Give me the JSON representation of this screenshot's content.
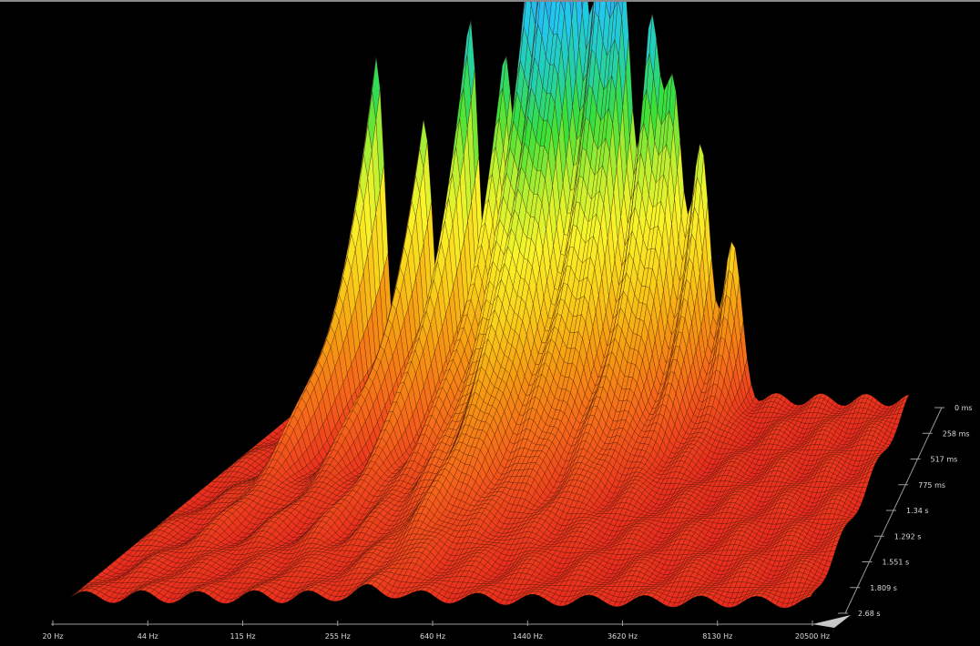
{
  "chart_data": {
    "type": "waterfall-3d",
    "x_ticks": [
      "20 Hz",
      "44 Hz",
      "115 Hz",
      "255 Hz",
      "640 Hz",
      "1440 Hz",
      "3620 Hz",
      "8130 Hz",
      "20500 Hz"
    ],
    "x_range_hz": [
      20,
      20500
    ],
    "x_scale": "log",
    "z_ticks": [
      "0 ms",
      "258 ms",
      "517 ms",
      "775 ms",
      "1.34 s",
      "1.292 s",
      "1.551 s",
      "1.809 s",
      "2.68 s"
    ],
    "z_range_s": [
      0,
      2.068
    ],
    "peaks": [
      {
        "freq_hz": 40,
        "level": 0.55,
        "decay_s": 0.9
      },
      {
        "freq_hz": 70,
        "level": 0.45,
        "decay_s": 0.9
      },
      {
        "freq_hz": 120,
        "level": 0.62,
        "decay_s": 1.0
      },
      {
        "freq_hz": 180,
        "level": 0.55,
        "decay_s": 1.0
      },
      {
        "freq_hz": 250,
        "level": 0.78,
        "decay_s": 1.0
      },
      {
        "freq_hz": 330,
        "level": 0.92,
        "decay_s": 1.2
      },
      {
        "freq_hz": 420,
        "level": 0.82,
        "decay_s": 1.1
      },
      {
        "freq_hz": 560,
        "level": 0.7,
        "decay_s": 1.0
      },
      {
        "freq_hz": 720,
        "level": 0.68,
        "decay_s": 0.9
      },
      {
        "freq_hz": 1000,
        "level": 0.6,
        "decay_s": 0.9
      },
      {
        "freq_hz": 1300,
        "level": 0.5,
        "decay_s": 0.8
      },
      {
        "freq_hz": 1800,
        "level": 0.42,
        "decay_s": 0.7
      },
      {
        "freq_hz": 2600,
        "level": 0.25,
        "decay_s": 0.5
      }
    ],
    "colormap": [
      "#e8281e",
      "#f5651a",
      "#f59a12",
      "#f8d21a",
      "#f8f52a",
      "#b8f032",
      "#38e038",
      "#22d0b0",
      "#21c8f0",
      "#2a8ef0",
      "#2c3ae0",
      "#b01ee0",
      "#f020f0"
    ]
  }
}
